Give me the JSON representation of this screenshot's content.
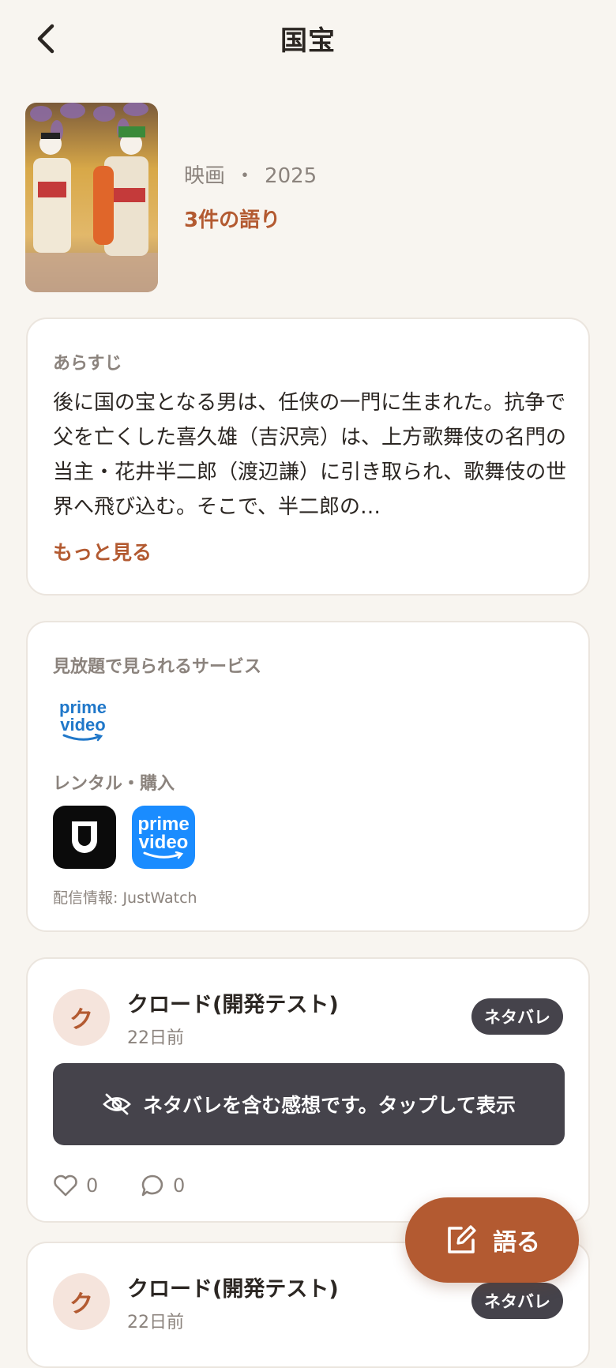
{
  "header": {
    "title": "国宝"
  },
  "work": {
    "category": "映画",
    "separator": "・",
    "year": "2025",
    "talk_count": "3件の語り"
  },
  "synopsis": {
    "label": "あらすじ",
    "text": "後に国の宝となる男は、任侠の一門に生まれた。抗争で父を亡くした喜久雄（吉沢亮）は、上方歌舞伎の名門の当主・花井半二郎（渡辺謙）に引き取られ、歌舞伎の世界へ飛び込む。そこで、半二郎の…",
    "more": "もっと見る"
  },
  "services": {
    "subscription_label": "見放題で見られるサービス",
    "rental_label": "レンタル・購入",
    "prime_word1": "prime",
    "prime_word2": "video",
    "credit": "配信情報: JustWatch"
  },
  "posts": [
    {
      "avatar_initial": "ク",
      "user": "クロード(開発テスト)",
      "time": "22日前",
      "badge": "ネタバレ",
      "spoiler_notice": "ネタバレを含む感想です。タップして表示",
      "likes": "0",
      "comments": "0"
    },
    {
      "avatar_initial": "ク",
      "user": "クロード(開発テスト)",
      "time": "22日前",
      "badge": "ネタバレ"
    }
  ],
  "fab": {
    "label": "語る"
  },
  "colors": {
    "accent": "#b35a31",
    "background": "#f8f5f0",
    "spoiler": "#45434b"
  }
}
